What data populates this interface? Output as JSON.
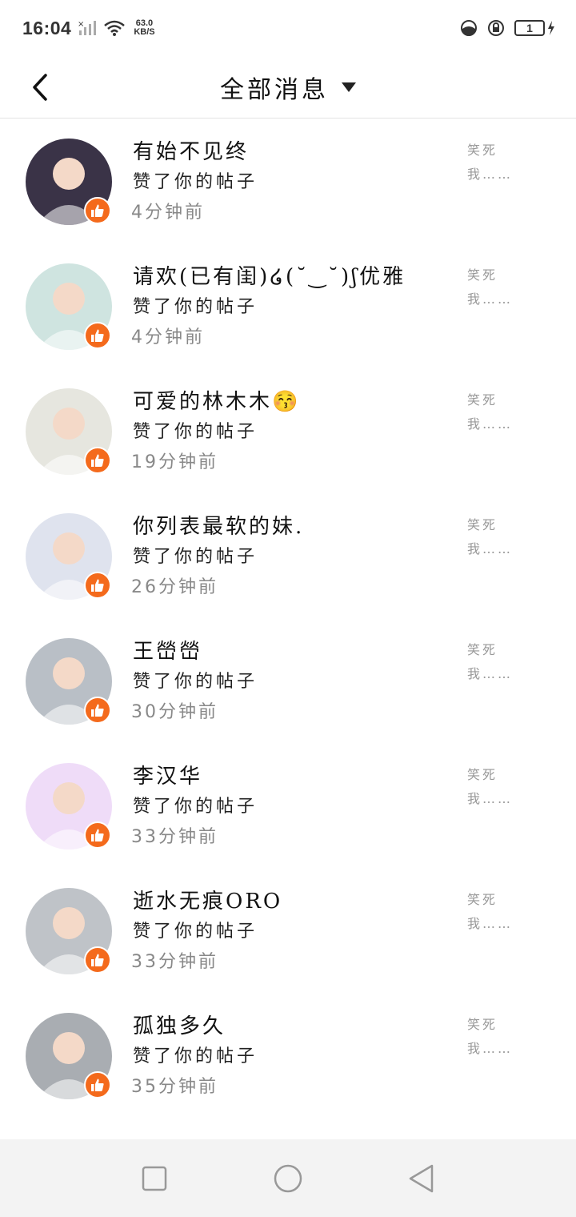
{
  "status_bar": {
    "time": "16:04",
    "net_speed_value": "63.0",
    "net_speed_unit": "KB/S",
    "battery_level": "1"
  },
  "header": {
    "title": "全部消息"
  },
  "messages": [
    {
      "name": "有始不见终",
      "action": "赞了你的帖子",
      "time": "4分钟前",
      "preview": "笑死\n我……",
      "avatar_color": "#3a3347"
    },
    {
      "name": "请欢(已有闺)໒(˘‿˘)ʃ优雅",
      "action": "赞了你的帖子",
      "time": "4分钟前",
      "preview": "笑死\n我……",
      "avatar_color": "#cfe4e0"
    },
    {
      "name": "可爱的林木木😚",
      "action": "赞了你的帖子",
      "time": "19分钟前",
      "preview": "笑死\n我……",
      "avatar_color": "#e6e6df"
    },
    {
      "name": "你列表最软的妹.",
      "action": "赞了你的帖子",
      "time": "26分钟前",
      "preview": "笑死\n我……",
      "avatar_color": "#dfe3ee"
    },
    {
      "name": "王嵤嵤",
      "action": "赞了你的帖子",
      "time": "30分钟前",
      "preview": "笑死\n我……",
      "avatar_color": "#b9bfc6"
    },
    {
      "name": "李汉华",
      "action": "赞了你的帖子",
      "time": "33分钟前",
      "preview": "笑死\n我……",
      "avatar_color": "#efdcf8"
    },
    {
      "name": "逝水无痕ORO",
      "action": "赞了你的帖子",
      "time": "33分钟前",
      "preview": "笑死\n我……",
      "avatar_color": "#bfc3c8"
    },
    {
      "name": "孤独多久",
      "action": "赞了你的帖子",
      "time": "35分钟前",
      "preview": "笑死\n我……",
      "avatar_color": "#a9adb2"
    }
  ],
  "colors": {
    "like_badge": "#f46a1c",
    "nav_bar": "#f3f3f3"
  },
  "icons": {
    "back": "chevron-left-icon",
    "dropdown": "caret-down-icon",
    "like": "thumbs-up-icon",
    "nav_recent": "square-icon",
    "nav_home": "circle-icon",
    "nav_back": "triangle-left-icon"
  }
}
